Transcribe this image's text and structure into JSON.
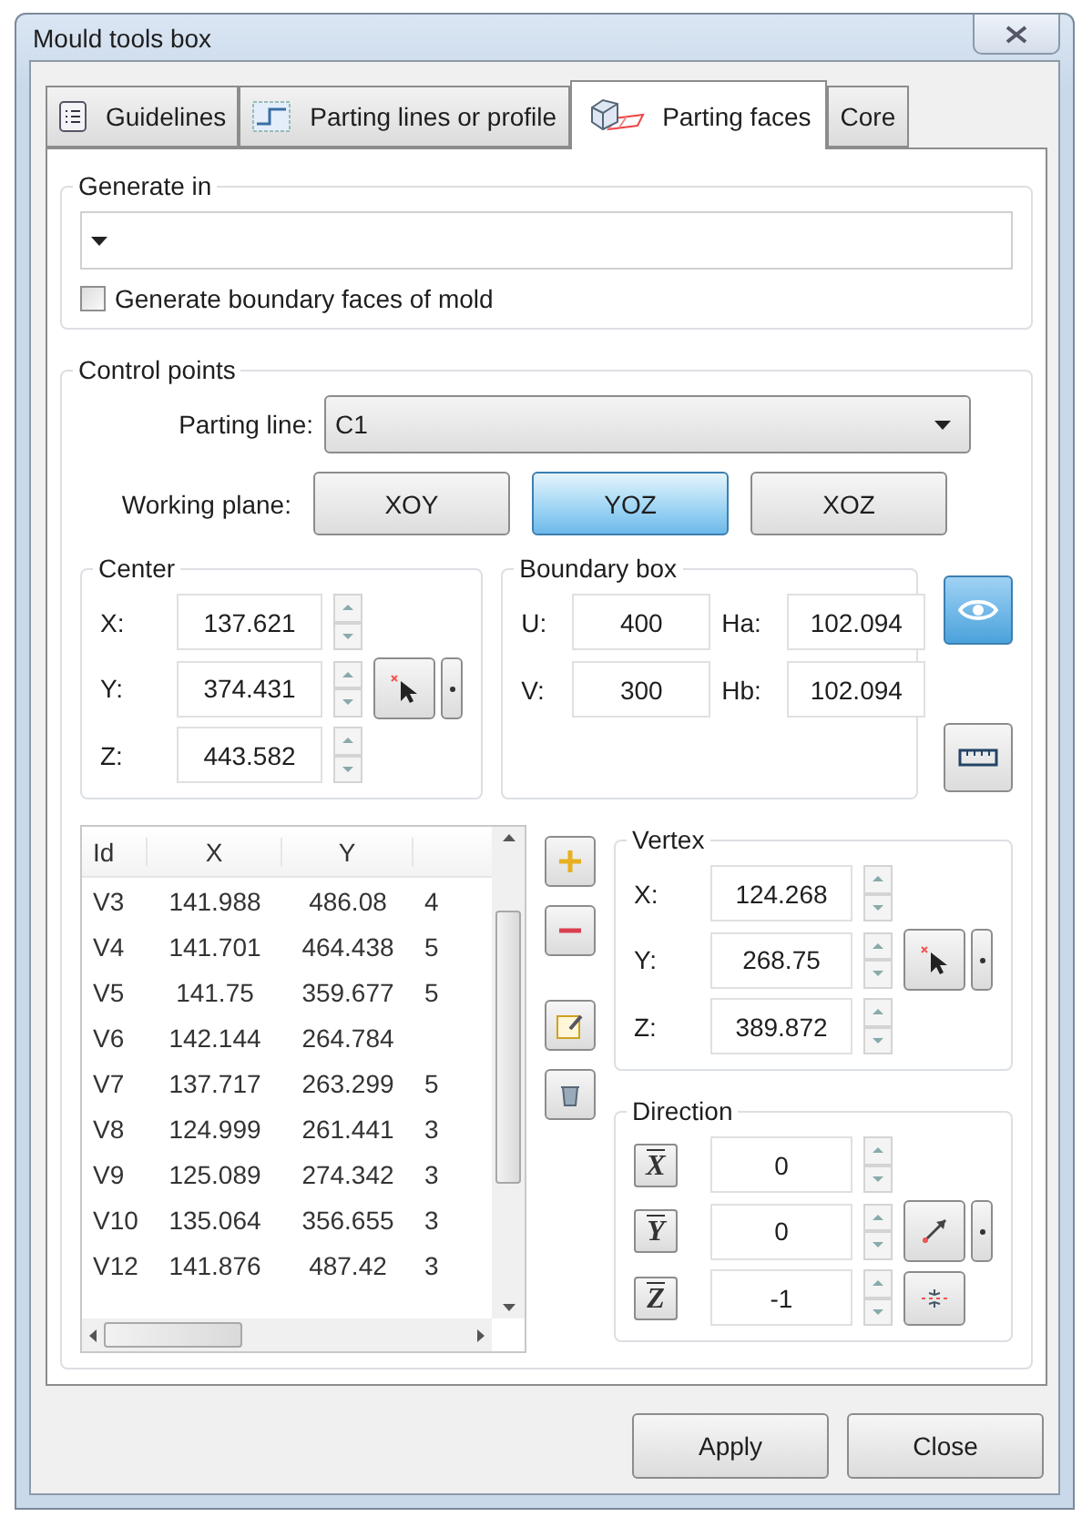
{
  "window": {
    "title": "Mould tools box"
  },
  "tabs": [
    {
      "label": "Guidelines",
      "kind": "list",
      "selected": false
    },
    {
      "label": "Parting lines or profile",
      "kind": "step",
      "selected": false
    },
    {
      "label": "Parting faces",
      "kind": "faces",
      "selected": true
    },
    {
      "label": "Core",
      "kind": "plain",
      "selected": false
    }
  ],
  "generate_in": {
    "title": "Generate in",
    "checkbox": {
      "label": "Generate boundary faces of mold",
      "checked": false
    }
  },
  "control_points": {
    "title": "Control points",
    "parting_line": {
      "label": "Parting line:",
      "value": "C1"
    },
    "working_plane": {
      "label": "Working plane:",
      "options": [
        {
          "label": "XOY",
          "selected": false
        },
        {
          "label": "YOZ",
          "selected": true
        },
        {
          "label": "XOZ",
          "selected": false
        }
      ]
    },
    "center": {
      "title": "Center",
      "fields": [
        {
          "label": "X:",
          "value": "137.621"
        },
        {
          "label": "Y:",
          "value": "374.431"
        },
        {
          "label": "Z:",
          "value": "443.582"
        }
      ]
    },
    "boundary_box": {
      "title": "Boundary box",
      "fields": [
        {
          "label": "U:",
          "value": "400"
        },
        {
          "label": "Ha:",
          "value": "102.094"
        },
        {
          "label": "V:",
          "value": "300"
        },
        {
          "label": "Hb:",
          "value": "102.094"
        }
      ]
    },
    "view_toggle": {
      "on": true
    },
    "table": {
      "columns": [
        "Id",
        "X",
        "Y"
      ],
      "rows": [
        [
          "V3",
          "141.988",
          "486.08",
          "4"
        ],
        [
          "V4",
          "141.701",
          "464.438",
          "5"
        ],
        [
          "V5",
          "141.75",
          "359.677",
          "5"
        ],
        [
          "V6",
          "142.144",
          "264.784"
        ],
        [
          "V7",
          "137.717",
          "263.299",
          "5"
        ],
        [
          "V8",
          "124.999",
          "261.441",
          "3"
        ],
        [
          "V9",
          "125.089",
          "274.342",
          "3"
        ],
        [
          "V10",
          "135.064",
          "356.655",
          "3"
        ],
        [
          "V12",
          "141.876",
          "487.42",
          "3"
        ]
      ]
    },
    "vertex": {
      "title": "Vertex",
      "fields": [
        {
          "label": "X:",
          "value": "124.268"
        },
        {
          "label": "Y:",
          "value": "268.75"
        },
        {
          "label": "Z:",
          "value": "389.872"
        }
      ]
    },
    "direction": {
      "title": "Direction",
      "fields": [
        {
          "label": "X",
          "value": "0"
        },
        {
          "label": "Y",
          "value": "0"
        },
        {
          "label": "Z",
          "value": "-1"
        }
      ]
    }
  },
  "buttons": [
    "Apply",
    "Close"
  ]
}
